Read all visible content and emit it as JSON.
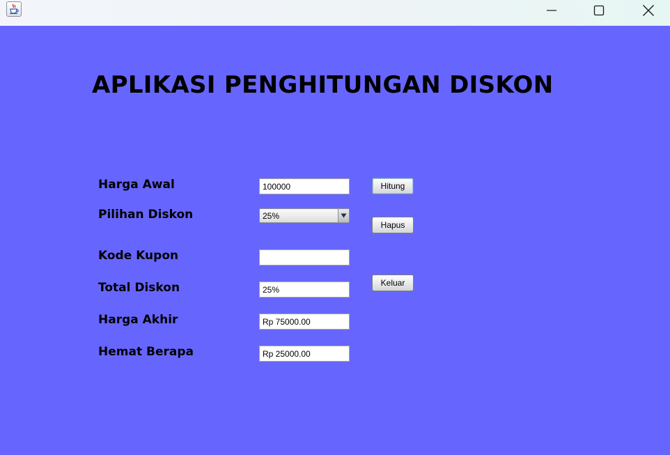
{
  "window": {
    "icon": "java-cup-icon",
    "controls": {
      "minimize": "minimize-icon",
      "maximize": "maximize-icon",
      "close": "close-icon"
    }
  },
  "app": {
    "title": "APLIKASI PENGHITUNGAN DISKON"
  },
  "form": {
    "harga_awal": {
      "label": "Harga Awal",
      "value": "100000"
    },
    "pilihan_diskon": {
      "label": "Pilihan Diskon",
      "value": "25%"
    },
    "kode_kupon": {
      "label": "Kode Kupon",
      "value": ""
    },
    "total_diskon": {
      "label": "Total Diskon",
      "value": "25%"
    },
    "harga_akhir": {
      "label": "Harga Akhir",
      "value": "Rp 75000.00"
    },
    "hemat_berapa": {
      "label": "Hemat Berapa",
      "value": "Rp 25000.00"
    }
  },
  "buttons": {
    "hitung": "Hitung",
    "hapus": "Hapus",
    "keluar": "Keluar"
  },
  "colors": {
    "background": "#6666ff",
    "titlebar": "#eef4f6"
  }
}
